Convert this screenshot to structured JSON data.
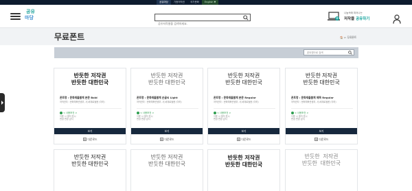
{
  "topbar": {
    "tabs": [
      "공유마당",
      "기증저작권",
      "국가문화",
      "English ▼"
    ]
  },
  "header": {
    "logo_line1": "공유",
    "logo_line2": "마당",
    "search_placeholder": "공유저작물을 검색하세요.",
    "share_caption": "나눔속에 피어나는",
    "share_title_a": "저작물",
    "share_title_b": "공유하기"
  },
  "page": {
    "title": "무료폰트",
    "breadcrumb": "🏠 > 무료폰트"
  },
  "filter": {
    "search_placeholder": "폰트명으로 검색"
  },
  "cards": [
    {
      "preview_line1": "반듯한 저작권",
      "preview_line2": "반듯한 대한민국",
      "font_name": "폰트명 : 문화재돌봄체 본문 Bold",
      "owner": "저작권자 : 문화체육관광부, 사)세계로돌봄 (이하)",
      "usage_label": "< 사용조건 >",
      "usage_detail": [
        "이용 시 출처 표시",
        "변경 변경 금지"
      ],
      "view_label": "보기",
      "download_label": "다운로드"
    },
    {
      "preview_line1": "반듯한 저작권",
      "preview_line2": "반듯한 대한민국",
      "font_name": "폰트명 : 문화재돌봄체 손글씨 Light",
      "owner": "저작권자 : 문화체육관광부, 사)세계로돌봄 (이하)",
      "usage_label": "< 사용조건 >",
      "usage_detail": [
        "이용 시 출처 표시",
        "변경 변경 금지"
      ],
      "view_label": "보기",
      "download_label": "다운로드"
    },
    {
      "preview_line1": "반듯한 저작권",
      "preview_line2": "반듯한 대한민국",
      "font_name": "폰트명 : 문화재돌봄체 본문 Regular",
      "owner": "저작권자 : 문화체육관광부, 사)세계로돌봄 (이하)",
      "usage_label": "< 사용조건 >",
      "usage_detail": [
        "이용 시 출처 표시",
        "변경 변경 금지"
      ],
      "view_label": "보기",
      "download_label": "다운로드"
    },
    {
      "preview_line1": "반듯한 저작권",
      "preview_line2": "반듯한 대한민국",
      "font_name": "폰트명 : 문화재돌봄체 제목 Regular",
      "owner": "저작권자 : 문화체육관광부, 사)세계로돌봄 (이하)",
      "usage_label": "< 사용조건 >",
      "usage_detail": [
        "이용 시 출처 표시",
        "변경 변경 금지"
      ],
      "view_label": "보기",
      "download_label": "다운로드"
    },
    {
      "preview_line1": "반듯한 저작권",
      "preview_line2": "반듯한 대한민국"
    },
    {
      "preview_line1": "반듯한 저작권",
      "preview_line2": "반듯한 대한민국"
    },
    {
      "preview_line1": "반듯한 저작권",
      "preview_line2": "반듯한 대한민국"
    },
    {
      "preview_line1": "반듯한 저작권",
      "preview_line2": "반듯한 대한민국"
    }
  ],
  "colors": {
    "topbar_bg": "#0d1b2e",
    "accent": "#12a29b",
    "button_bg": "#16283d",
    "usage_green": "#2e9e4f",
    "filter_bg": "#c7ced6"
  }
}
